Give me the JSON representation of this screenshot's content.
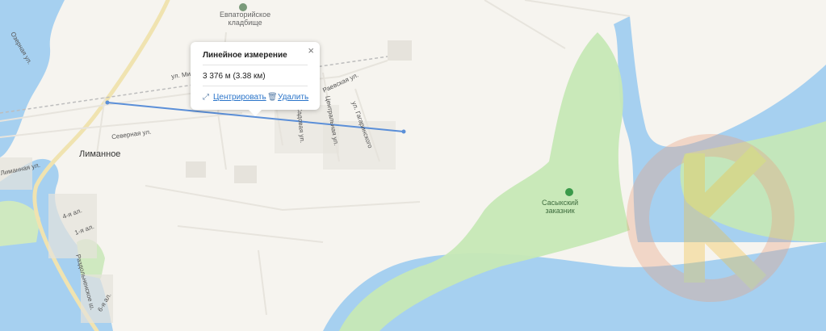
{
  "map": {
    "labels": {
      "cemetery": "Евпаторийское кладбище",
      "cemetery_l1": "Евпаторийское",
      "cemetery_l2": "кладбище",
      "limannoe": "Лиманное",
      "severnaya": "Северная ул.",
      "ozernaya": "Озерная ул.",
      "limannaya": "Лиманная ул.",
      "mira": "ул. Мира",
      "gagarinskogo": "ул. Гагаринского",
      "sadovaya": "Садовая ул.",
      "tsentralnaya": "Центральная ул.",
      "rayaevskaya": "Раевская ул.",
      "razdolnenskoe": "Раздольненское ш.",
      "al4": "4-я ал.",
      "al1": "1-я ал.",
      "al6": "6-я ал.",
      "reserve_l1": "Сасыкский",
      "reserve_l2": "заказник"
    },
    "colors": {
      "land": "#f6f4ef",
      "water": "#a6d0f0",
      "park": "#c6e8b5",
      "measure_line": "#5b8fd8",
      "link": "#2a74c9"
    }
  },
  "popup": {
    "title": "Линейное измерение",
    "close_icon": "×",
    "value": "3 376 м (3.38 км)",
    "center_icon": "crosshair-icon",
    "center_label": "Центрировать",
    "delete_icon": "trash-icon",
    "delete_label": "Удалить"
  }
}
